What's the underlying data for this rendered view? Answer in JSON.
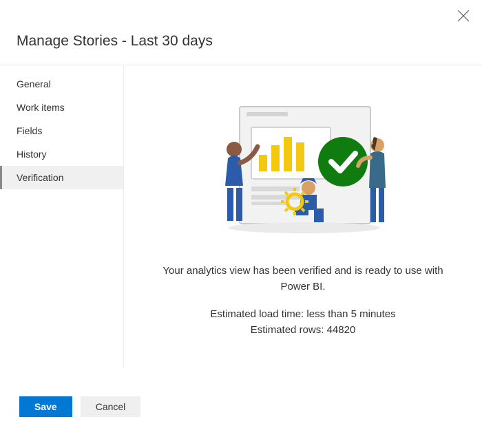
{
  "dialog": {
    "title": "Manage Stories - Last 30 days"
  },
  "sidebar": {
    "items": [
      {
        "label": "General"
      },
      {
        "label": "Work items"
      },
      {
        "label": "Fields"
      },
      {
        "label": "History"
      },
      {
        "label": "Verification"
      }
    ],
    "selected_index": 4
  },
  "main": {
    "message": "Your analytics view has been verified and is ready to use with Power BI.",
    "estimated_load_time_label": "Estimated load time:",
    "estimated_load_time_value": "less than 5 minutes",
    "estimated_rows_label": "Estimated rows:",
    "estimated_rows_value": "44820"
  },
  "footer": {
    "save_label": "Save",
    "cancel_label": "Cancel"
  }
}
